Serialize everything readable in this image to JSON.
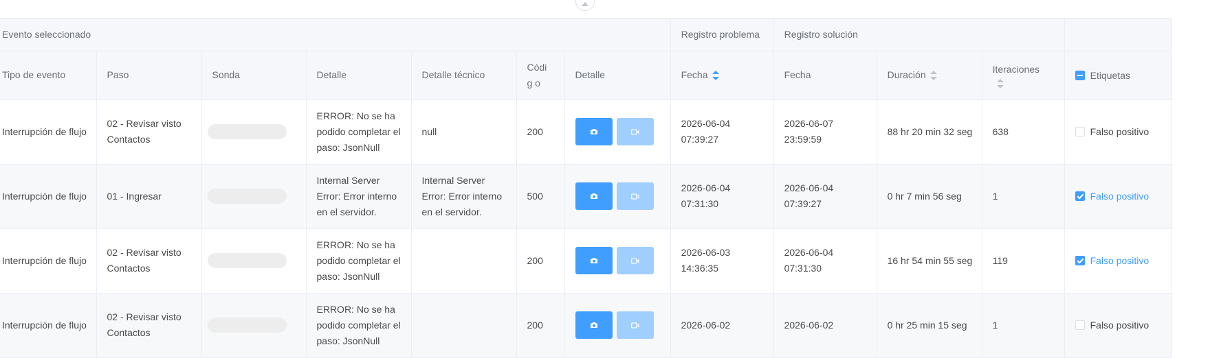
{
  "header": {
    "group_event": "Evento seleccionado",
    "group_problem": "Registro problema",
    "group_solution": "Registro solución",
    "columns": {
      "tipo": "Tipo de evento",
      "paso": "Paso",
      "sonda": "Sonda",
      "detalle": "Detalle",
      "detalle_tecnico": "Detalle técnico",
      "codigo": "Códig o",
      "detalle_media": "Detalle",
      "fecha_problema": "Fecha",
      "fecha_solucion": "Fecha",
      "duracion": "Duración",
      "iteraciones": "Iteraciones",
      "etiquetas": "Etiquetas"
    }
  },
  "rows": [
    {
      "tipo": "Interrupción de flujo",
      "paso": "02 - Revisar visto Contactos",
      "detalle": "ERROR: No se ha podido completar el paso: JsonNull",
      "detalle_tecnico": "null",
      "codigo": "200",
      "fecha_problema": "2026-06-04 07:39:27",
      "fecha_solucion": "2026-06-07 23:59:59",
      "duracion": "88 hr 20 min 32 seg",
      "iteraciones": "638",
      "etiqueta": "Falso positivo",
      "etiqueta_checked": false
    },
    {
      "tipo": "Interrupción de flujo",
      "paso": "01 - Ingresar",
      "detalle": "Internal Server Error: Error interno en el servidor.",
      "detalle_tecnico": "Internal Server Error: Error interno en el servidor.",
      "codigo": "500",
      "fecha_problema": "2026-06-04 07:31:30",
      "fecha_solucion": "2026-06-04 07:39:27",
      "duracion": "0 hr 7 min 56 seg",
      "iteraciones": "1",
      "etiqueta": "Falso positivo",
      "etiqueta_checked": true
    },
    {
      "tipo": "Interrupción de flujo",
      "paso": "02 - Revisar visto Contactos",
      "detalle": "ERROR: No se ha podido completar el paso: JsonNull",
      "detalle_tecnico": "",
      "codigo": "200",
      "fecha_problema": "2026-06-03 14:36:35",
      "fecha_solucion": "2026-06-04 07:31:30",
      "duracion": "16 hr 54 min 55 seg",
      "iteraciones": "119",
      "etiqueta": "Falso positivo",
      "etiqueta_checked": true
    },
    {
      "tipo": "Interrupción de flujo",
      "paso": "02 - Revisar visto Contactos",
      "detalle": "ERROR: No se ha podido completar el paso: JsonNull",
      "detalle_tecnico": "",
      "codigo": "200",
      "fecha_problema": "2026-06-02",
      "fecha_solucion": "2026-06-02",
      "duracion": "0 hr 25 min 15 seg",
      "iteraciones": "1",
      "etiqueta": "Falso positivo",
      "etiqueta_checked": false
    }
  ],
  "colors": {
    "accent": "#409eff",
    "accent_light": "#a0cfff",
    "header_bg": "#f5f7fa"
  },
  "icons": {
    "photo": "camera-icon",
    "video": "video-camera-icon",
    "collapse": "chevron-up-icon"
  }
}
